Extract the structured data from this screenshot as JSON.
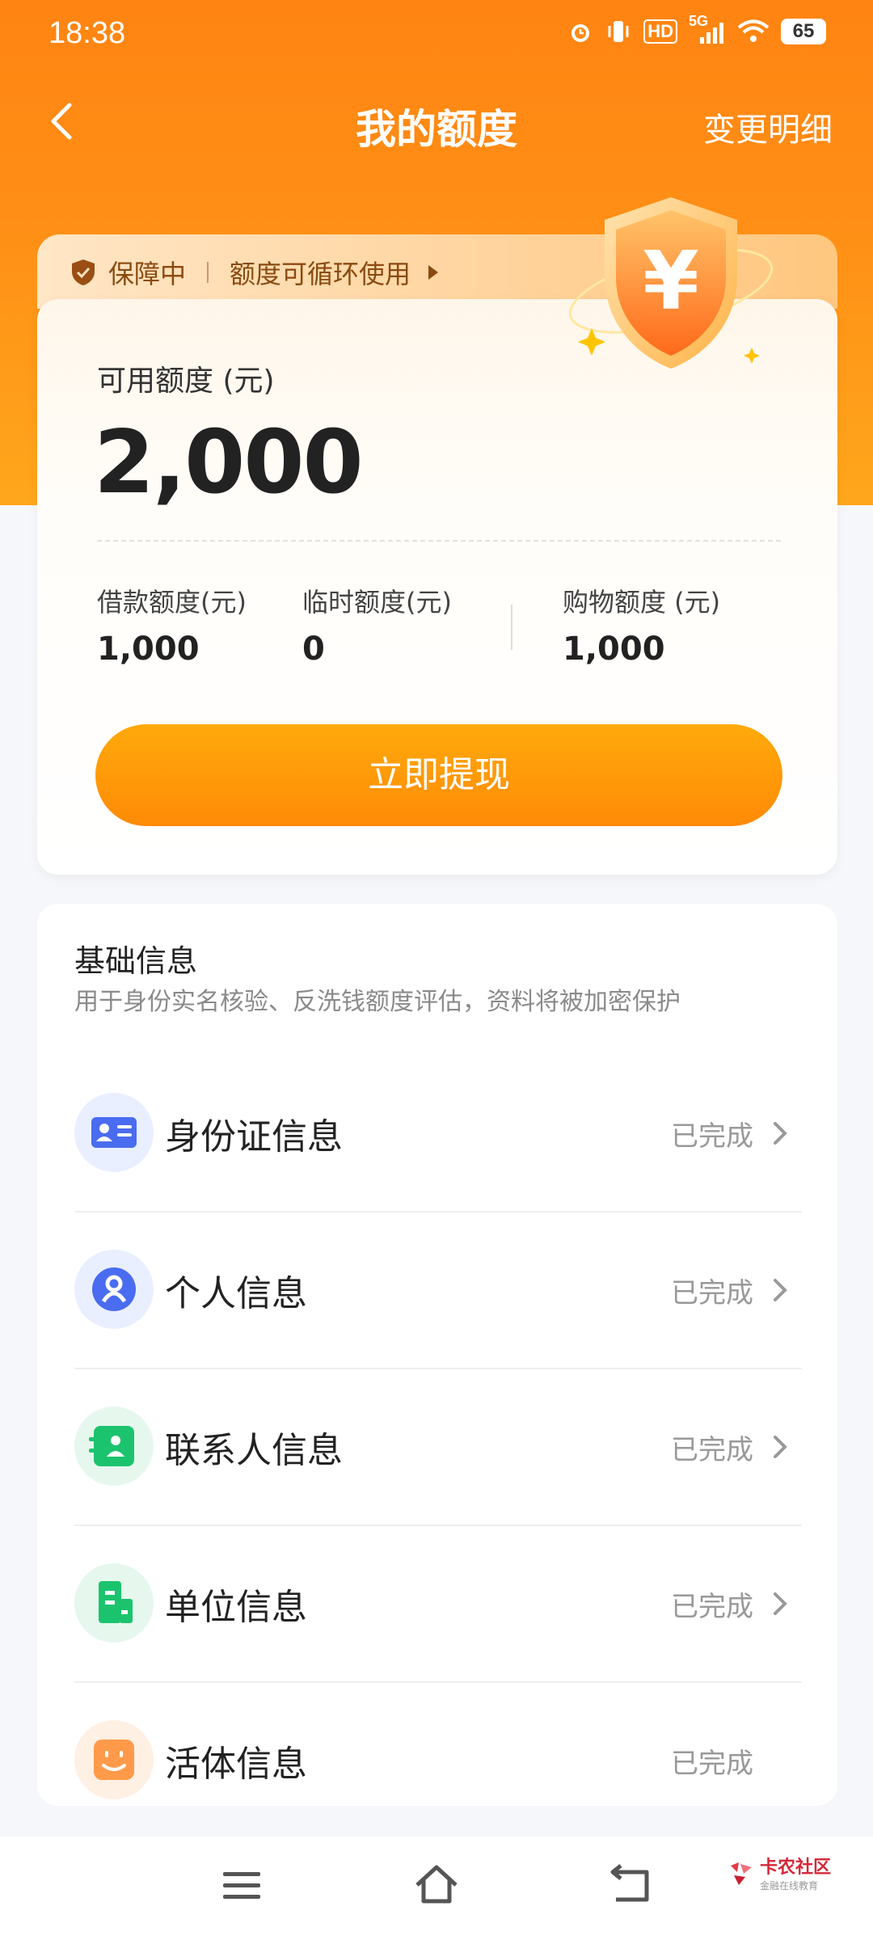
{
  "status_bar": {
    "time": "18:38",
    "network": "5G",
    "hd": "HD",
    "battery": "65"
  },
  "nav": {
    "title": "我的额度",
    "right_link": "变更明细"
  },
  "guarantee": {
    "status": "保障中",
    "note": "额度可循环使用"
  },
  "credit": {
    "available_label": "可用额度 (元)",
    "available_amount": "2,000",
    "loan_label": "借款额度(元)",
    "loan_value": "1,000",
    "temp_label": "临时额度(元)",
    "temp_value": "0",
    "shopping_label": "购物额度 (元)",
    "shopping_value": "1,000",
    "withdraw_button": "立即提现"
  },
  "basic_info": {
    "title": "基础信息",
    "description": "用于身份实名核验、反洗钱额度评估，资料将被加密保护",
    "items": [
      {
        "label": "身份证信息",
        "status": "已完成",
        "icon": "id-card-icon",
        "color": "#4a6cf0"
      },
      {
        "label": "个人信息",
        "status": "已完成",
        "icon": "person-icon",
        "color": "#4a6cf0"
      },
      {
        "label": "联系人信息",
        "status": "已完成",
        "icon": "contacts-icon",
        "color": "#1cc36e"
      },
      {
        "label": "单位信息",
        "status": "已完成",
        "icon": "building-icon",
        "color": "#1cc36e"
      },
      {
        "label": "活体信息",
        "status": "已完成",
        "icon": "face-icon",
        "color": "#ff8a2a"
      }
    ]
  },
  "watermark": {
    "name": "卡农社区",
    "tagline": "金融在线教育"
  },
  "colors": {
    "brand_orange": "#ff8412",
    "button_orange": "#ff9a08"
  }
}
